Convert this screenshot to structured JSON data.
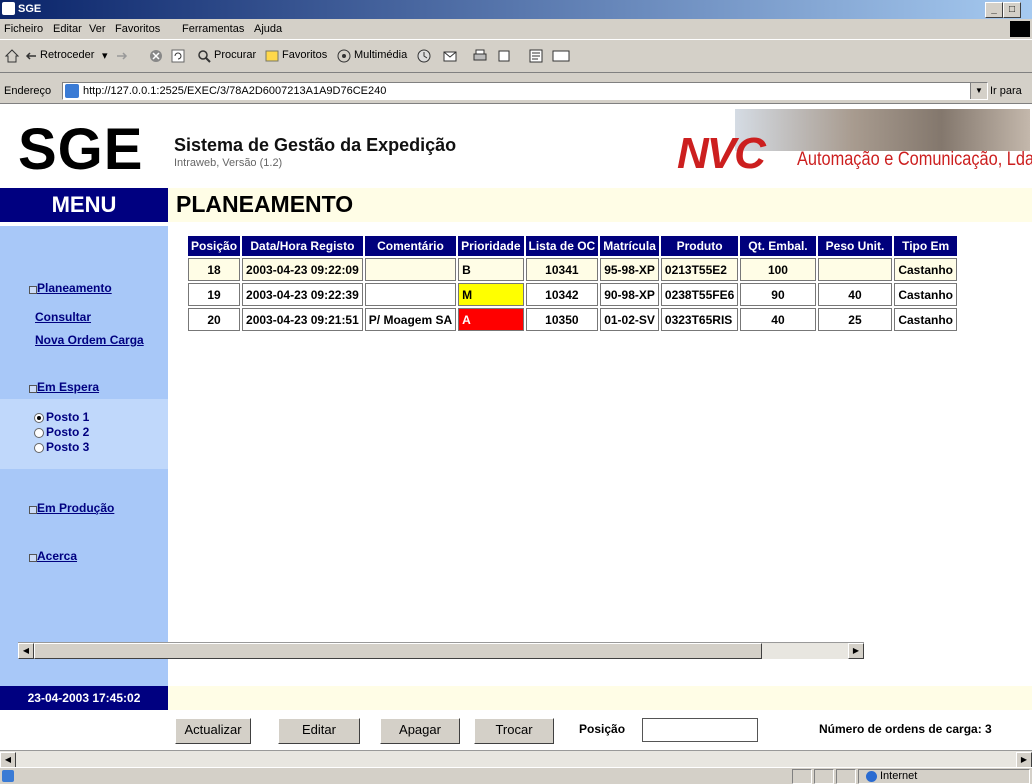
{
  "window": {
    "title": "SGE"
  },
  "menubar": [
    "Ficheiro",
    "Editar",
    "Ver",
    "Favoritos",
    "Ferramentas",
    "Ajuda"
  ],
  "toolbar": {
    "back": "Retroceder",
    "search": "Procurar",
    "favorites": "Favoritos",
    "media": "Multimédia"
  },
  "address": {
    "label": "Endereço",
    "url": "http://127.0.0.1:2525/EXEC/3/78A2D6007213A1A9D76CE240",
    "go": "Ir para"
  },
  "header": {
    "logo": "SGE",
    "title": "Sistema de Gestão da Expedição",
    "subtitle": "Intraweb, Versão (1.2)",
    "company_logo": "NVC",
    "company_tagline": "Automação e Comunicação, Lda."
  },
  "menu": {
    "title": "MENU",
    "items": [
      {
        "label": "Planeamento"
      },
      {
        "label": "Consultar"
      },
      {
        "label": "Nova Ordem Carga"
      },
      {
        "label": "Em Espera"
      },
      {
        "label": "Em Produção"
      },
      {
        "label": "Acerca"
      }
    ],
    "posts": [
      {
        "label": "Posto 1",
        "checked": true
      },
      {
        "label": "Posto 2",
        "checked": false
      },
      {
        "label": "Posto 3",
        "checked": false
      }
    ],
    "clock": "23-04-2003 17:45:02"
  },
  "page_title": "PLANEAMENTO",
  "grid": {
    "columns": [
      "Posição",
      "Data/Hora Registo",
      "Comentário",
      "Prioridade",
      "Lista de OC",
      "Matrícula",
      "Produto",
      "Qt. Embal.",
      "Peso Unit.",
      "Tipo Em"
    ],
    "rows": [
      {
        "pos": "18",
        "data": "2003-04-23 09:22:09",
        "coment": "",
        "prio": "B",
        "lista": "10341",
        "matr": "95-98-XP",
        "prod": "0213T55E2",
        "qt": "100",
        "peso": "",
        "tipo": "Castanho"
      },
      {
        "pos": "19",
        "data": "2003-04-23 09:22:39",
        "coment": "",
        "prio": "M",
        "lista": "10342",
        "matr": "90-98-XP",
        "prod": "0238T55FE6",
        "qt": "90",
        "peso": "40",
        "tipo": "Castanho"
      },
      {
        "pos": "20",
        "data": "2003-04-23 09:21:51",
        "coment": "P/ Moagem SA",
        "prio": "A",
        "lista": "10350",
        "matr": "01-02-SV",
        "prod": "0323T65RIS",
        "qt": "40",
        "peso": "25",
        "tipo": "Castanho"
      }
    ],
    "priority_colors": {
      "B": "#ffffff",
      "M": "#ffff00",
      "A": "#ff0000"
    }
  },
  "actions": {
    "refresh": "Actualizar",
    "edit": "Editar",
    "delete": "Apagar",
    "swap": "Trocar",
    "position_label": "Posição",
    "position_value": "",
    "count_text": "Número de ordens de carga: 3"
  },
  "status": {
    "zone": "Internet"
  }
}
